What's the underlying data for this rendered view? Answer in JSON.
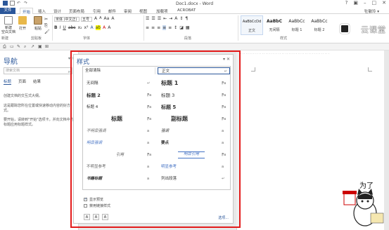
{
  "window": {
    "title": "Doc1.docx - Word"
  },
  "ribbon_tabs": [
    "文件",
    "开始",
    "插入",
    "设计",
    "页面布局",
    "引用",
    "邮件",
    "审阅",
    "视图",
    "加载项",
    "ACROBAT"
  ],
  "user": "牡敏玲 ▾",
  "ribbon": {
    "new_label": "新建\n空白文档",
    "open_label": "打开",
    "paste_label": "粘贴",
    "font_name": "宋体 (中文正)",
    "font_size": "五号",
    "group_labels": {
      "clipboard": "剪贴板",
      "font": "字体",
      "paragraph": "段落",
      "styles": "样式"
    },
    "style_gallery": [
      {
        "preview": "AaBbCcDd",
        "name": "正文"
      },
      {
        "preview": "AaBbC",
        "name": "无间隔"
      },
      {
        "preview": "AaBbCc",
        "name": "标题 1"
      },
      {
        "preview": "AaBbCc",
        "name": "标题 2"
      }
    ],
    "watermark": "云课堂"
  },
  "nav": {
    "title": "导航",
    "search_placeholder": "搜索文档",
    "tabs": [
      "标题",
      "页面",
      "结果"
    ],
    "paragraphs": [
      "创建文档的交互式大纲。",
      "这是跟踪您所在位置或快速移动内容的好方式。",
      "要开始，请转到\"开始\"选项卡，并向文档中的标题应用标题样式。"
    ]
  },
  "styles_pane": {
    "title": "样式",
    "clear_all": "全部清除",
    "entries": [
      {
        "left": "无间隔",
        "left_mark": "↵",
        "right": "标题 1",
        "right_mark": "⁋a"
      },
      {
        "left": "标题 2",
        "left_mark": "⁋a",
        "right": "标题 3",
        "right_mark": "⁋a"
      },
      {
        "left": "标题 4",
        "left_mark": "⁋a",
        "right": "标题 5",
        "right_mark": "⁋a"
      },
      {
        "left": "标题",
        "left_mark": "⁋a",
        "right": "副标题",
        "right_mark": "⁋a"
      },
      {
        "left": "不明显强调",
        "left_mark": "a",
        "right": "强调",
        "right_mark": "a"
      },
      {
        "left": "明显强调",
        "left_mark": "a",
        "right": "要点",
        "right_mark": "a"
      },
      {
        "left": "引用",
        "left_mark": "⁋a",
        "right": "明显引用",
        "right_mark": "⁋a"
      },
      {
        "left": "不明显参考",
        "left_mark": "a",
        "right": "明显参考",
        "right_mark": "a"
      },
      {
        "left": "书籍标题",
        "left_mark": "a",
        "right": "列出段落",
        "right_mark": "↵"
      }
    ],
    "selected": "正文",
    "show_preview": "显示预览",
    "disable_linked": "禁用链接样式",
    "options": "选项..."
  },
  "mascot_sign": "为了"
}
